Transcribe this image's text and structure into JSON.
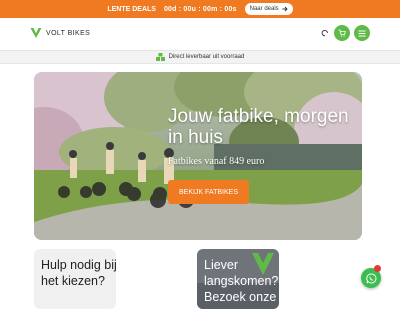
{
  "promo": {
    "label": "LENTE DEALS",
    "countdown": "00d : 00u : 00m : 00s",
    "button": "Naar deals"
  },
  "header": {
    "brand": "VOLT BIKES"
  },
  "subbar": {
    "text": "Direct leverbaar uit voorraad"
  },
  "hero": {
    "title": "Jouw fatbike, morgen in huis",
    "subtitle": "Fatbikes vanaf 849 euro",
    "button": "BEKIJK FATBIKES"
  },
  "cards": [
    {
      "text": "Hulp nodig bij het kiezen?"
    },
    {
      "text": "Liever langskomen? Bezoek onze"
    }
  ],
  "colors": {
    "accent": "#f07a21",
    "brand_green": "#5fba46",
    "whatsapp": "#3bbd4f"
  },
  "icons": [
    "arrow-right-icon",
    "brand-logo-icon",
    "user-icon",
    "cart-icon",
    "menu-icon",
    "box-icon",
    "whatsapp-icon"
  ]
}
